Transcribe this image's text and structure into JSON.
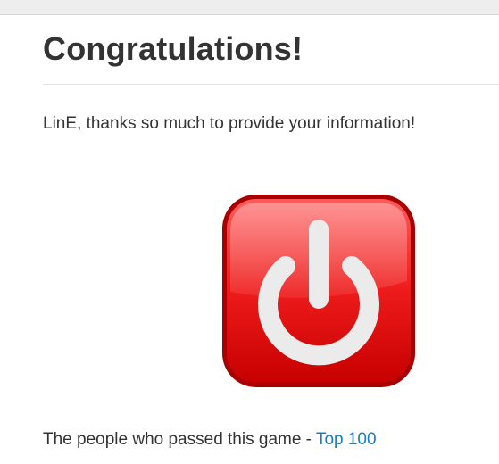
{
  "page": {
    "title": "Congratulations!",
    "message": "LinE, thanks so much to provide your information!"
  },
  "icon": {
    "name": "power-icon",
    "colors": {
      "border": "#b30000",
      "fill_top": "#ff4d4d",
      "fill_bottom": "#d40000",
      "symbol": "#ebebeb"
    }
  },
  "footer": {
    "text": "The people who passed this game - ",
    "link_label": "Top 100",
    "link_color": "#1a7cc1"
  }
}
